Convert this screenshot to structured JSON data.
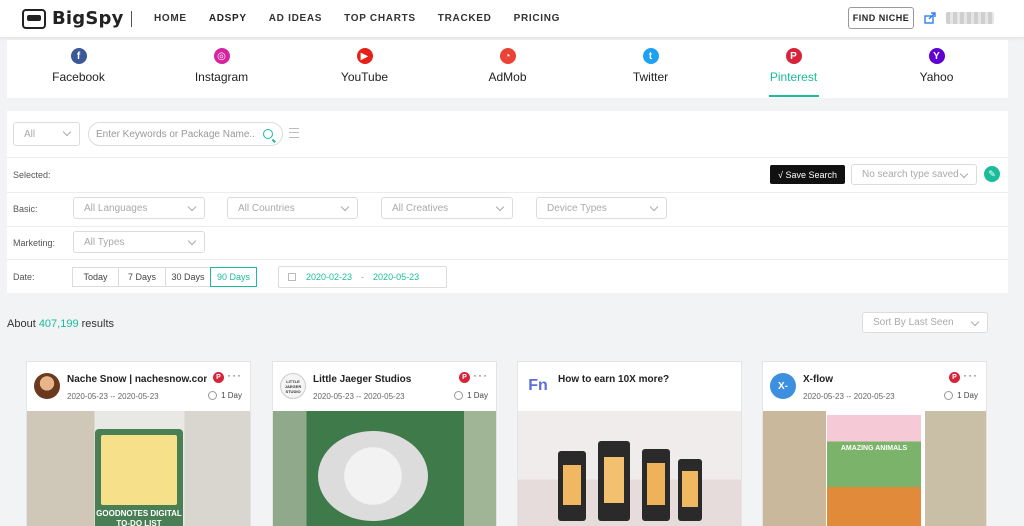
{
  "app": {
    "logo_text": "BigSpy",
    "nav": [
      "HOME",
      "ADSPY",
      "AD IDEAS",
      "TOP CHARTS",
      "TRACKED",
      "PRICING"
    ],
    "active_nav": "ADSPY",
    "find_niche": "FIND NICHE"
  },
  "platforms": [
    {
      "label": "Facebook",
      "icon": "facebook-icon",
      "glyph": "f",
      "color": "#3b5998"
    },
    {
      "label": "Instagram",
      "icon": "instagram-icon",
      "glyph": "◎",
      "color": "#d6249f"
    },
    {
      "label": "YouTube",
      "icon": "youtube-icon",
      "glyph": "▶",
      "color": "#e62117"
    },
    {
      "label": "AdMob",
      "icon": "admob-icon",
      "glyph": "◔",
      "color": "#ea4335"
    },
    {
      "label": "Twitter",
      "icon": "twitter-icon",
      "glyph": "t",
      "color": "#1da1f2"
    },
    {
      "label": "Pinterest",
      "icon": "pinterest-icon",
      "glyph": "P",
      "color": "#d6243a"
    },
    {
      "label": "Yahoo",
      "icon": "yahoo-icon",
      "glyph": "Y",
      "color": "#5f01d1"
    }
  ],
  "active_platform": "Pinterest",
  "filters": {
    "type_select": "All",
    "search_placeholder": "Enter Keywords or Package Name...",
    "selected_label": "Selected:",
    "save_search": "Save Search",
    "saved_search_placeholder": "No search type saved",
    "basic_label": "Basic:",
    "basic_selects": [
      "All Languages",
      "All Countries",
      "All Creatives",
      "Device Types"
    ],
    "marketing_label": "Marketing:",
    "marketing_select": "All Types",
    "date_label": "Date:",
    "date_tabs": [
      "Today",
      "7 Days",
      "30 Days",
      "90 Days"
    ],
    "active_date_tab": "90 Days",
    "date_from": "2020-02-23",
    "date_sep": "-",
    "date_to": "2020-05-23"
  },
  "results": {
    "prefix": "About",
    "count": "407,199",
    "suffix": "results",
    "sort": "Sort By Last Seen"
  },
  "cards": [
    {
      "title": "Nache Snow | nachesnow.com",
      "dates": "2020-05-23 -- 2020-05-23",
      "duration": "1 Day",
      "avatar_text": "",
      "img_caption": "GOODNOTES DIGITAL TO-DO LIST"
    },
    {
      "title": "Little Jaeger Studios",
      "dates": "2020-05-23 -- 2020-05-23",
      "duration": "1 Day",
      "avatar_text": "LITTLE JAEGER STUDIO",
      "img_caption": ""
    },
    {
      "title": "How to earn 10X more?",
      "dates": "",
      "duration": "",
      "avatar_text": "Fn",
      "img_caption": ""
    },
    {
      "title": "X-flow",
      "dates": "2020-05-23 -- 2020-05-23",
      "duration": "1 Day",
      "avatar_text": "X-",
      "img_caption": "AMAZING ANIMALS"
    }
  ]
}
